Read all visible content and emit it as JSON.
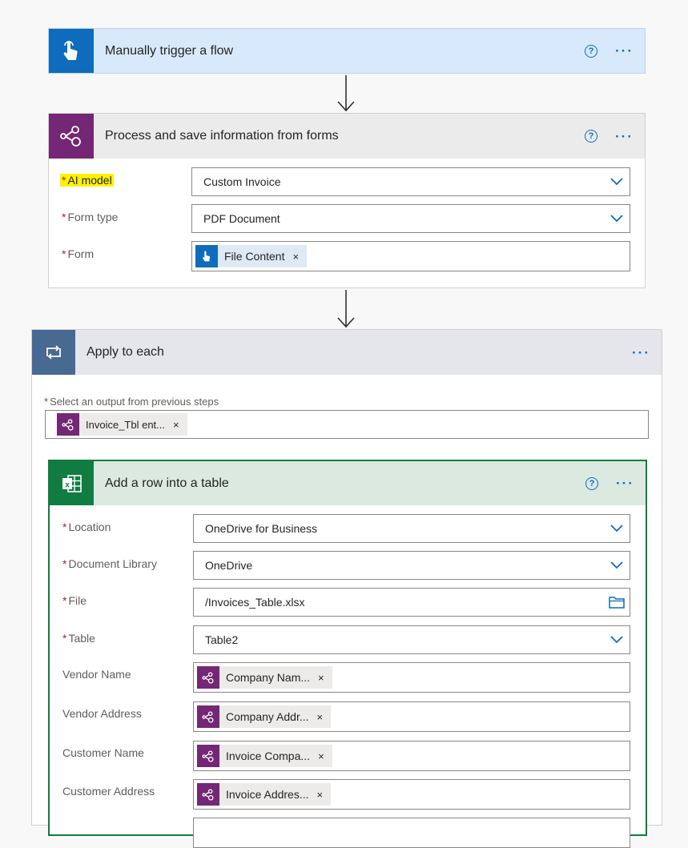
{
  "trigger": {
    "title": "Manually trigger a flow",
    "help": "?",
    "more": "···"
  },
  "process": {
    "title": "Process and save information from forms",
    "help": "?",
    "more": "···",
    "fields": {
      "ai_model": {
        "label": "AI model",
        "value": "Custom Invoice"
      },
      "form_type": {
        "label": "Form type",
        "value": "PDF Document"
      },
      "form": {
        "label": "Form",
        "token": "File Content",
        "remove": "×"
      }
    }
  },
  "apply": {
    "title": "Apply to each",
    "more": "···",
    "select_label": "Select an output from previous steps",
    "select_token": "Invoice_Tbl ent...",
    "remove": "×"
  },
  "addrow": {
    "title": "Add a row into a table",
    "help": "?",
    "more": "···",
    "fields": {
      "location": {
        "label": "Location",
        "value": "OneDrive for Business"
      },
      "library": {
        "label": "Document Library",
        "value": "OneDrive"
      },
      "file": {
        "label": "File",
        "value": "/Invoices_Table.xlsx"
      },
      "table": {
        "label": "Table",
        "value": "Table2"
      },
      "vendor_name": {
        "label": "Vendor Name",
        "token": "Company Nam..."
      },
      "vendor_address": {
        "label": "Vendor Address",
        "token": "Company Addr..."
      },
      "customer_name": {
        "label": "Customer Name",
        "token": "Invoice Compa..."
      },
      "customer_address": {
        "label": "Customer Address",
        "token": "Invoice Addres..."
      }
    },
    "remove": "×"
  },
  "required_mark": "*",
  "colors": {
    "trigger": "#0f6cbd",
    "ai_builder": "#742774",
    "loop": "#486991",
    "excel": "#107c41",
    "link": "#0f6cbd"
  }
}
